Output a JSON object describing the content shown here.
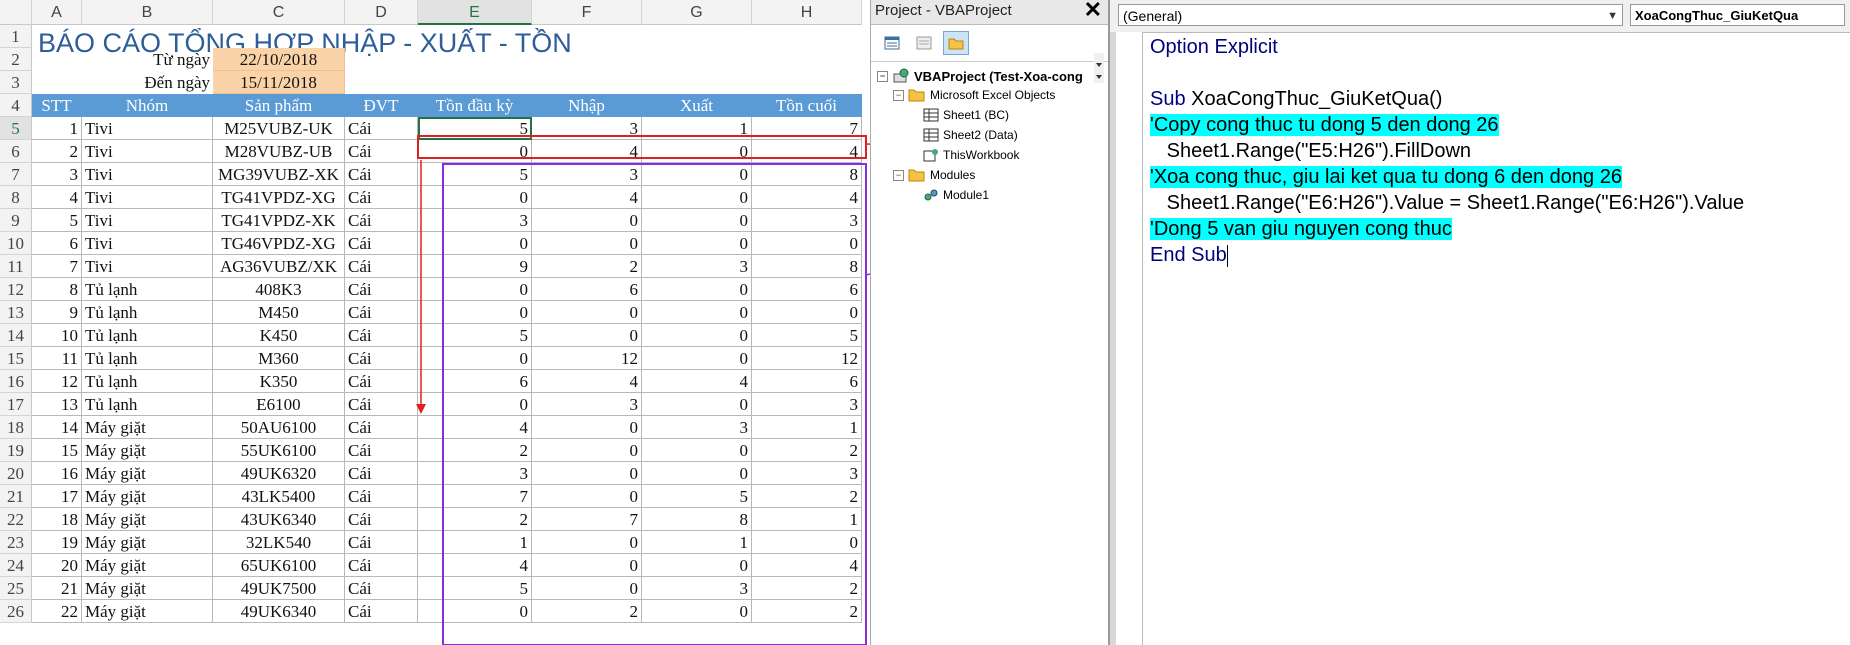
{
  "sheet": {
    "columns": [
      "A",
      "B",
      "C",
      "D",
      "E",
      "F",
      "G",
      "H"
    ],
    "selected_column": "E",
    "selected_row": "5",
    "title": "BÁO CÁO TỔNG HỢP NHẬP - XUẤT - TỒN",
    "from_label": "Từ ngày",
    "from_date": "22/10/2018",
    "to_label": "Đến ngày",
    "to_date": "15/11/2018",
    "headers": [
      "STT",
      "Nhóm",
      "Sản phẩm",
      "ĐVT",
      "Tồn đầu kỳ",
      "Nhập",
      "Xuất",
      "Tồn cuối"
    ],
    "rows": [
      [
        "1",
        "Tivi",
        "M25VUBZ-UK",
        "Cái",
        "5",
        "3",
        "1",
        "7"
      ],
      [
        "2",
        "Tivi",
        "M28VUBZ-UB",
        "Cái",
        "0",
        "4",
        "0",
        "4"
      ],
      [
        "3",
        "Tivi",
        "MG39VUBZ-XK",
        "Cái",
        "5",
        "3",
        "0",
        "8"
      ],
      [
        "4",
        "Tivi",
        "TG41VPDZ-XG",
        "Cái",
        "0",
        "4",
        "0",
        "4"
      ],
      [
        "5",
        "Tivi",
        "TG41VPDZ-XK",
        "Cái",
        "3",
        "0",
        "0",
        "3"
      ],
      [
        "6",
        "Tivi",
        "TG46VPDZ-XG",
        "Cái",
        "0",
        "0",
        "0",
        "0"
      ],
      [
        "7",
        "Tivi",
        "AG36VUBZ/XK",
        "Cái",
        "9",
        "2",
        "3",
        "8"
      ],
      [
        "8",
        "Tủ lạnh",
        "408K3",
        "Cái",
        "0",
        "6",
        "0",
        "6"
      ],
      [
        "9",
        "Tủ lạnh",
        "M450",
        "Cái",
        "0",
        "0",
        "0",
        "0"
      ],
      [
        "10",
        "Tủ lạnh",
        "K450",
        "Cái",
        "5",
        "0",
        "0",
        "5"
      ],
      [
        "11",
        "Tủ lạnh",
        "M360",
        "Cái",
        "0",
        "12",
        "0",
        "12"
      ],
      [
        "12",
        "Tủ lạnh",
        "K350",
        "Cái",
        "6",
        "4",
        "4",
        "6"
      ],
      [
        "13",
        "Tủ lạnh",
        "E6100",
        "Cái",
        "0",
        "3",
        "0",
        "3"
      ],
      [
        "14",
        "Máy giặt",
        "50AU6100",
        "Cái",
        "4",
        "0",
        "3",
        "1"
      ],
      [
        "15",
        "Máy giặt",
        "55UK6100",
        "Cái",
        "2",
        "0",
        "0",
        "2"
      ],
      [
        "16",
        "Máy giặt",
        "49UK6320",
        "Cái",
        "3",
        "0",
        "0",
        "3"
      ],
      [
        "17",
        "Máy giặt",
        "43LK5400",
        "Cái",
        "7",
        "0",
        "5",
        "2"
      ],
      [
        "18",
        "Máy giặt",
        "43UK6340",
        "Cái",
        "2",
        "7",
        "8",
        "1"
      ],
      [
        "19",
        "Máy giặt",
        "32LK540",
        "Cái",
        "1",
        "0",
        "1",
        "0"
      ],
      [
        "20",
        "Máy giặt",
        "65UK6100",
        "Cái",
        "4",
        "0",
        "0",
        "4"
      ],
      [
        "21",
        "Máy giặt",
        "49UK7500",
        "Cái",
        "5",
        "0",
        "3",
        "2"
      ],
      [
        "22",
        "Máy giặt",
        "49UK6340",
        "Cái",
        "0",
        "2",
        "0",
        "2"
      ]
    ],
    "colors": {
      "header_fill": "#5b9bd5",
      "date_fill": "#fbd3a8",
      "title_color": "#2e5d9a",
      "red_box": "#e02020",
      "purple_box": "#8a2be2"
    }
  },
  "project": {
    "title": "Project - VBAProject",
    "close": "✕",
    "root": "VBAProject (Test-Xoa-cong",
    "excel_objects": "Microsoft Excel Objects",
    "sheet1": "Sheet1 (BC)",
    "sheet2": "Sheet2 (Data)",
    "workbook": "ThisWorkbook",
    "modules": "Modules",
    "module1": "Module1"
  },
  "code": {
    "object_combo": "(General)",
    "proc_combo": "XoaCongThuc_GiuKetQua",
    "line_option_kw": "Option Explicit",
    "line_sub_kw": "Sub",
    "line_sub_name": " XoaCongThuc_GiuKetQua()",
    "comment1": "'Copy cong thuc tu dong 5 den dong 26",
    "statement1": "   Sheet1.Range(\"E5:H26\").FillDown",
    "comment2": "'Xoa cong thuc, giu lai ket qua tu dong 6 den dong 26",
    "statement2": "   Sheet1.Range(\"E6:H26\").Value = Sheet1.Range(\"E6:H26\").Value",
    "comment3": "'Dong 5 van giu nguyen cong thuc",
    "line_end_kw": "End Sub"
  }
}
